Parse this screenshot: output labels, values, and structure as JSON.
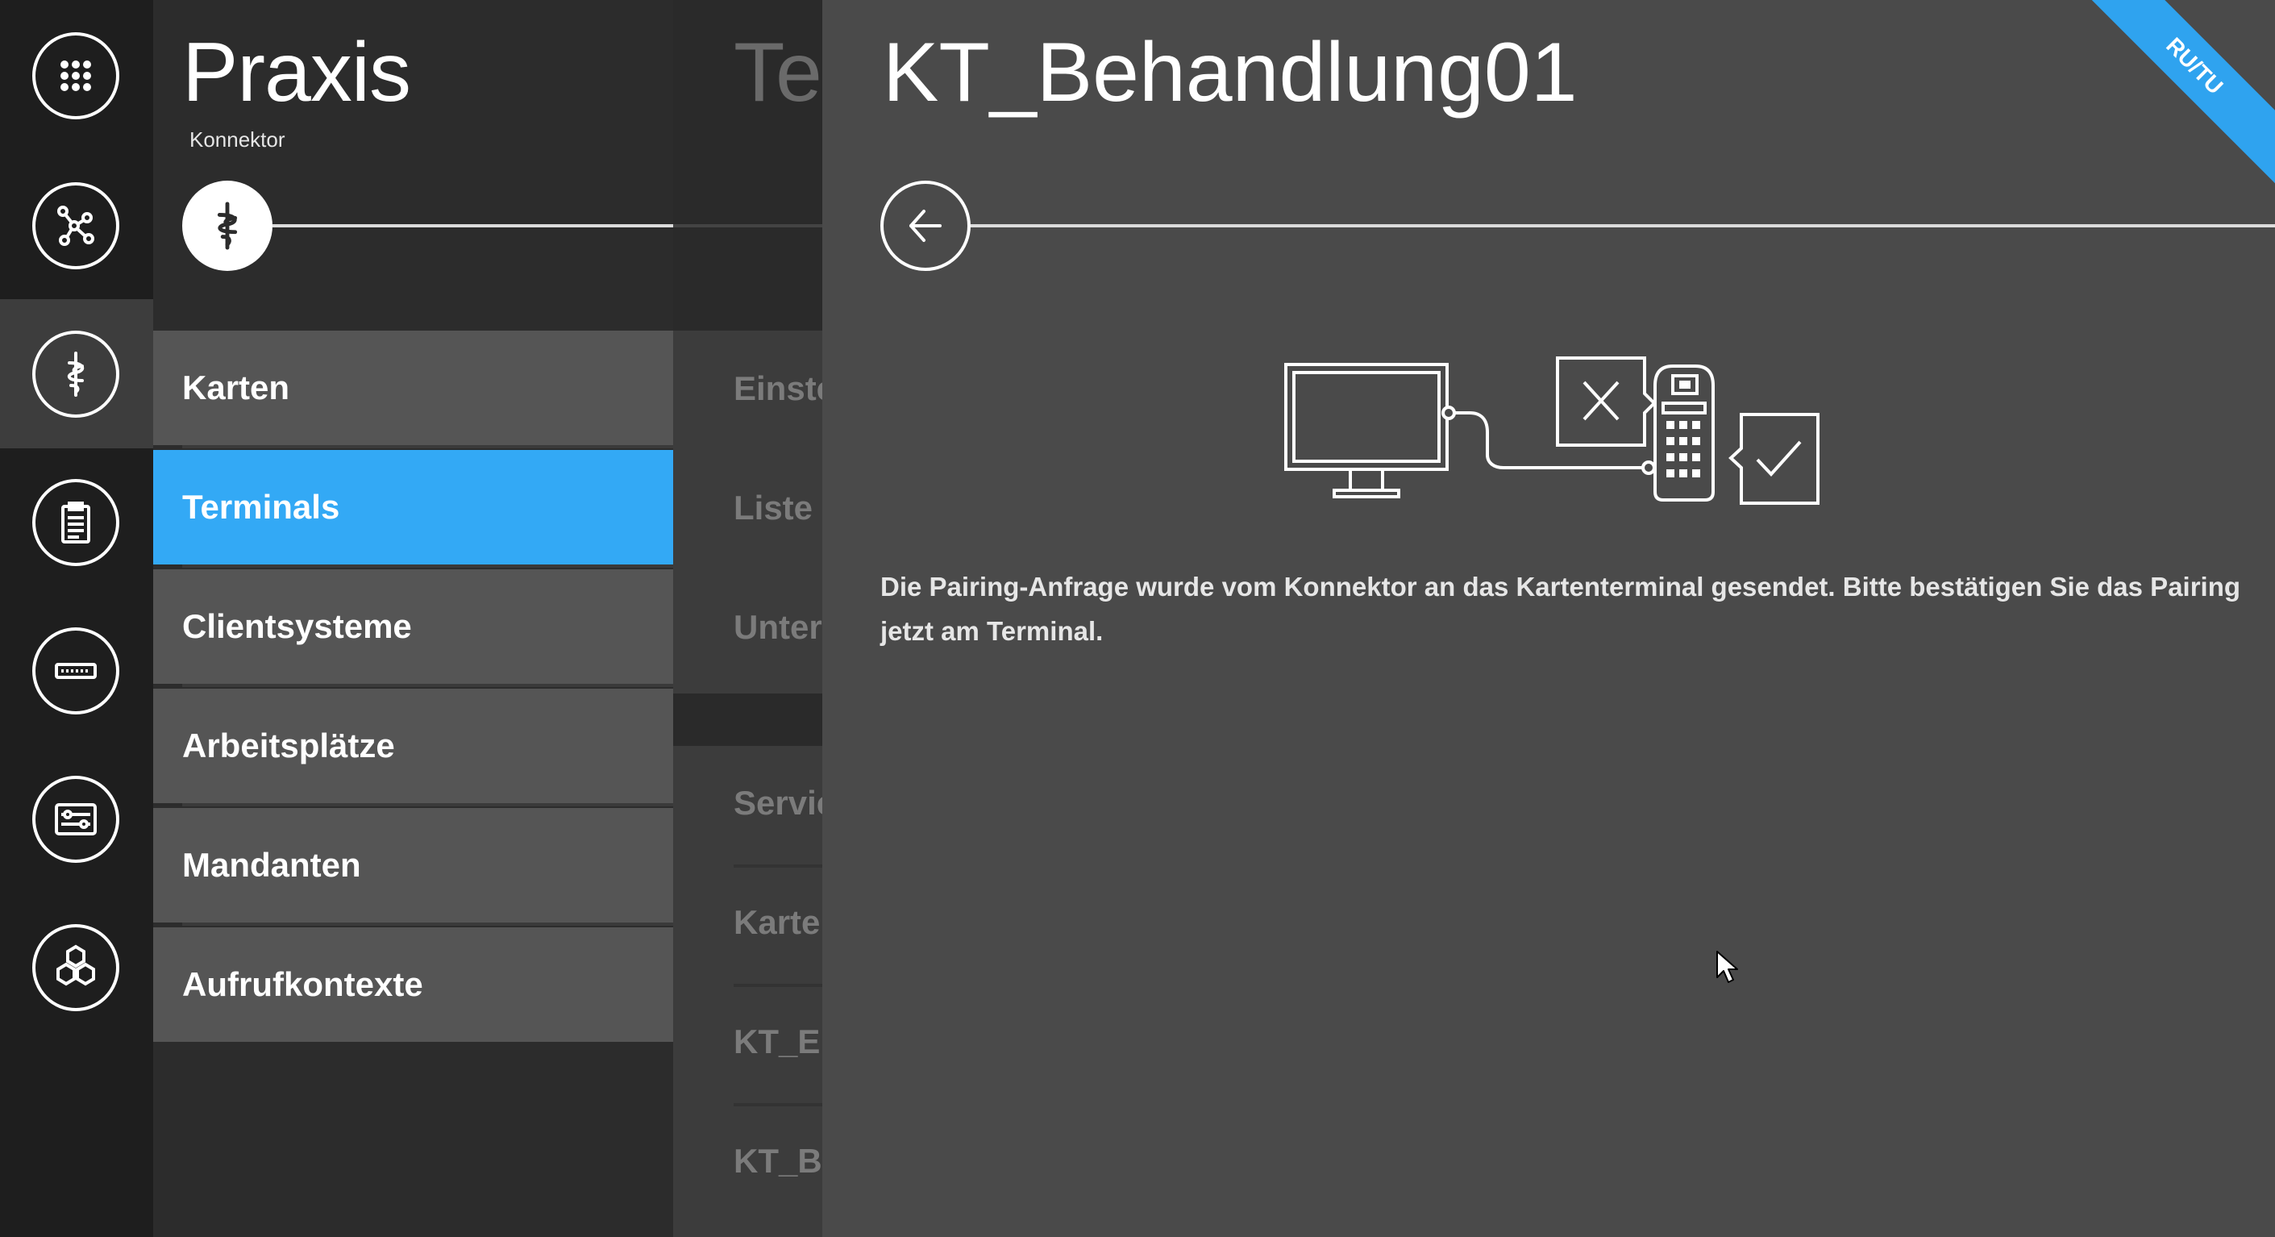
{
  "rail": {
    "icons": [
      "apps-grid-icon",
      "network-nodes-icon",
      "caduceus-icon",
      "clipboard-icon",
      "card-reader-icon",
      "settings-sliders-icon",
      "modules-hexagon-icon"
    ],
    "active_index": 2
  },
  "subnav": {
    "title": "Praxis",
    "subtitle": "Konnektor",
    "items": [
      {
        "label": "Karten"
      },
      {
        "label": "Terminals"
      },
      {
        "label": "Clientsysteme"
      },
      {
        "label": "Arbeitsplätze"
      },
      {
        "label": "Mandanten"
      },
      {
        "label": "Aufrufkontexte"
      }
    ],
    "active_item": "Terminals"
  },
  "column3": {
    "title": "Te",
    "items": [
      "Einste",
      "Liste c",
      "Unter",
      "Servic",
      "Karter",
      "KT_Er",
      "KT_Be"
    ]
  },
  "main": {
    "title": "KT_Behandlung01",
    "message": "Die Pairing-Anfrage wurde vom Konnektor an das Kartenterminal gesendet. Bitte bestätigen Sie das Pairing jetzt am Terminal.",
    "corner_badge": "RU/TU"
  },
  "colors": {
    "accent": "#33a9f5",
    "rail_bg": "#1e1e1e",
    "subnav_bg": "#2c2c2c",
    "nav_item_bg": "#555555",
    "main_bg": "#4a4a4a"
  }
}
